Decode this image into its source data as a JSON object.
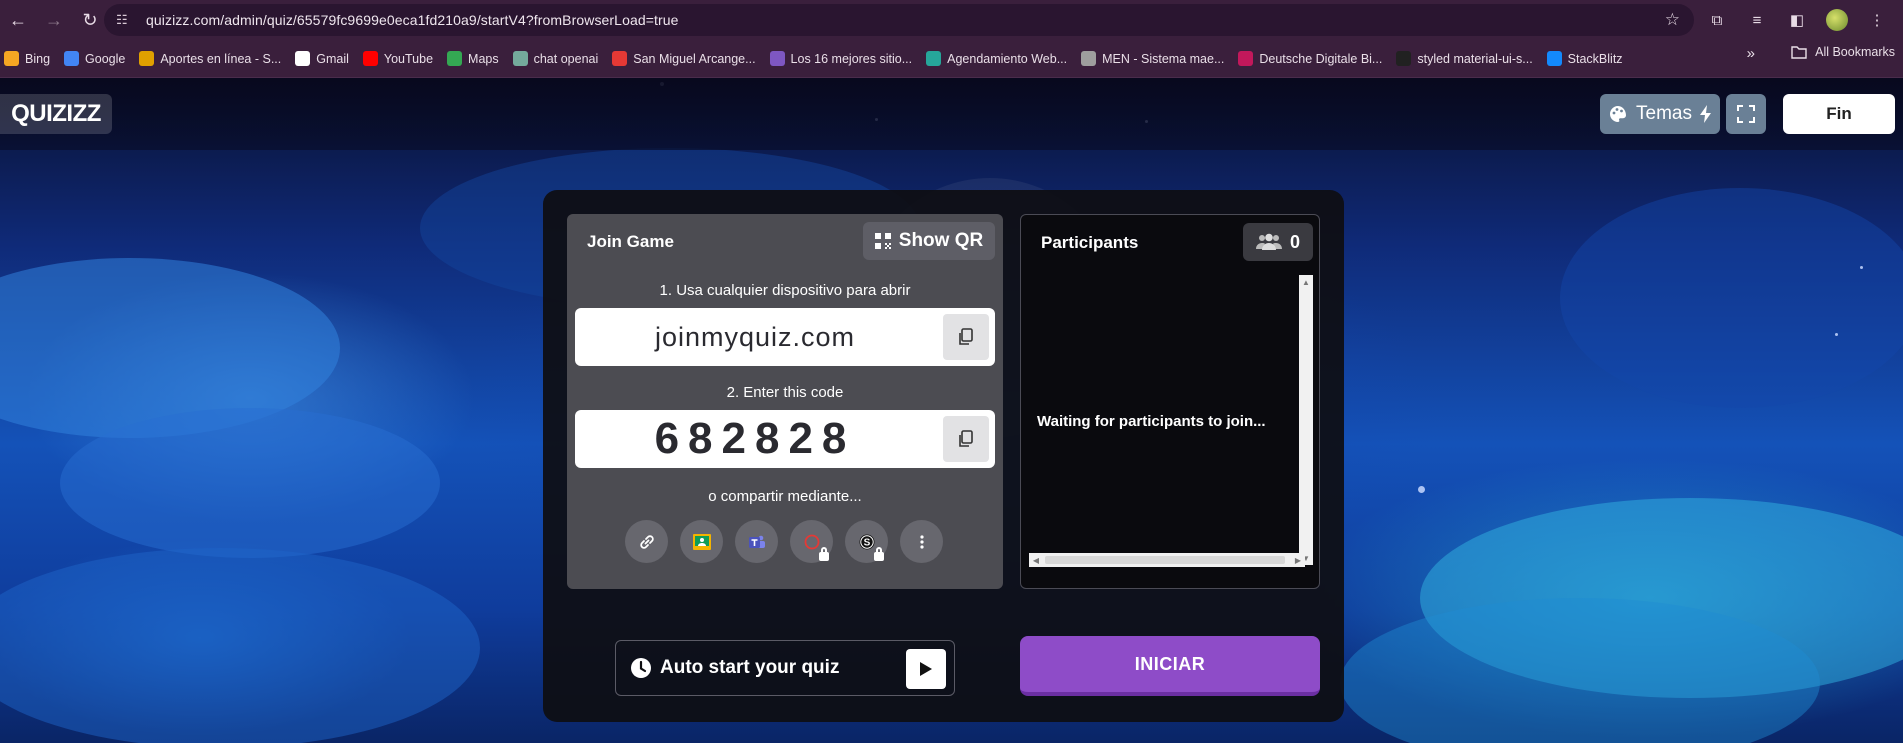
{
  "browser": {
    "url": "quizizz.com/admin/quiz/65579fc9699e0eca1fd210a9/startV4?fromBrowserLoad=true",
    "bookmarks": [
      {
        "label": "Bing",
        "color": "#f5a623",
        "icon": "bing-icon"
      },
      {
        "label": "Google",
        "color": "#4285f4",
        "icon": "google-icon"
      },
      {
        "label": "Aportes en línea - S...",
        "color": "#e0a000",
        "icon": "aportes-icon"
      },
      {
        "label": "Gmail",
        "color": "#ffffff",
        "icon": "gmail-icon"
      },
      {
        "label": "YouTube",
        "color": "#ff0000",
        "icon": "youtube-icon"
      },
      {
        "label": "Maps",
        "color": "#34a853",
        "icon": "maps-icon"
      },
      {
        "label": "chat openai",
        "color": "#74aa9c",
        "icon": "openai-icon"
      },
      {
        "label": "San Miguel Arcange...",
        "color": "#e53935",
        "icon": "san-miguel-icon"
      },
      {
        "label": "Los 16 mejores sitio...",
        "color": "#7e57c2",
        "icon": "los16-icon"
      },
      {
        "label": "Agendamiento Web...",
        "color": "#26a69a",
        "icon": "agendamiento-icon"
      },
      {
        "label": "MEN - Sistema mae...",
        "color": "#9e9e9e",
        "icon": "globe-icon"
      },
      {
        "label": "Deutsche Digitale Bi...",
        "color": "#c2185b",
        "icon": "deutsche-icon"
      },
      {
        "label": "styled material-ui-s...",
        "color": "#212121",
        "icon": "styled-icon"
      },
      {
        "label": "StackBlitz",
        "color": "#1389fd",
        "icon": "stackblitz-icon"
      }
    ],
    "more_label": "»",
    "all_bookmarks": "All Bookmarks"
  },
  "header": {
    "logo": "QUIZIZZ",
    "temas_label": "Temas",
    "fin_label": "Fin"
  },
  "join": {
    "title": "Join Game",
    "show_qr": "Show QR",
    "step1": "1. Usa cualquier dispositivo para abrir",
    "join_url": "joinmyquiz.com",
    "step2": "2. Enter this code",
    "code": "682828",
    "share_label": "o compartir mediante...",
    "share_options": [
      {
        "icon": "link-icon",
        "locked": false
      },
      {
        "icon": "google-classroom-icon",
        "locked": false
      },
      {
        "icon": "microsoft-teams-icon",
        "locked": false
      },
      {
        "icon": "schoology-icon",
        "locked": true
      },
      {
        "icon": "canvas-icon",
        "locked": true
      },
      {
        "icon": "more-options-icon",
        "locked": false
      }
    ]
  },
  "participants": {
    "title": "Participants",
    "count": "0",
    "waiting_text": "Waiting for participants to join..."
  },
  "actions": {
    "auto_start_label": "Auto start your quiz",
    "iniciar_label": "INICIAR"
  },
  "colors": {
    "iniciar": "#8e4cc8",
    "panel": "#0e0e12",
    "join_card": "#4c4c52"
  }
}
